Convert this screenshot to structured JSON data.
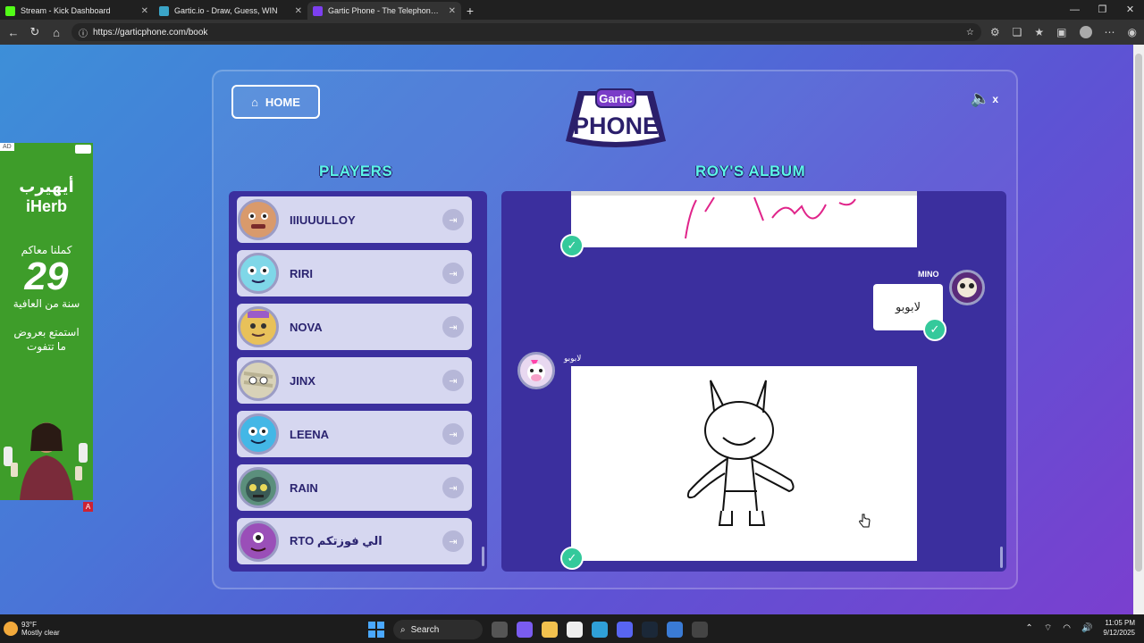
{
  "browser": {
    "tabs": [
      {
        "title": "Stream - Kick Dashboard",
        "color": "#53fc18"
      },
      {
        "title": "Gartic.io - Draw, Guess, WIN",
        "color": "#3aa4c7"
      },
      {
        "title": "Gartic Phone - The Telephone Game",
        "color": "#7d3ff0"
      }
    ],
    "url": "https://garticphone.com/book"
  },
  "game": {
    "home_label": "HOME",
    "logo_top": "Gartic",
    "logo_main": "PHONE",
    "mute_label": "x",
    "players_title": "PLAYERS",
    "album_title": "ROY'S ALBUM",
    "players": [
      {
        "name": "IIIUUULLOY",
        "color": "#d99a6c"
      },
      {
        "name": "RIRI",
        "color": "#7fd7e8"
      },
      {
        "name": "NOVA",
        "color": "#e8c15a"
      },
      {
        "name": "JINX",
        "color": "#d8d2b8"
      },
      {
        "name": "LEENA",
        "color": "#43b7e6"
      },
      {
        "name": "RAIN",
        "color": "#5b8f7c"
      },
      {
        "name": "RTO الي فوزتكم",
        "color": "#9a4fb8"
      }
    ],
    "guess_user": "MINO",
    "guess_text": "لابوبو",
    "drawer_label": "لابوبو"
  },
  "ad": {
    "tag": "AD",
    "brand_ar": "أيهيرب",
    "brand": "iHerb",
    "line1": "كملنا معاكم",
    "number": "29",
    "line2": "سنة من العافية",
    "line3": "استمتع بعروض",
    "line4": "ما تتفوت",
    "badge": "A"
  },
  "taskbar": {
    "temp": "93°F",
    "weather": "Mostly clear",
    "search": "Search",
    "time": "11:05 PM",
    "date": "9/12/2025"
  }
}
